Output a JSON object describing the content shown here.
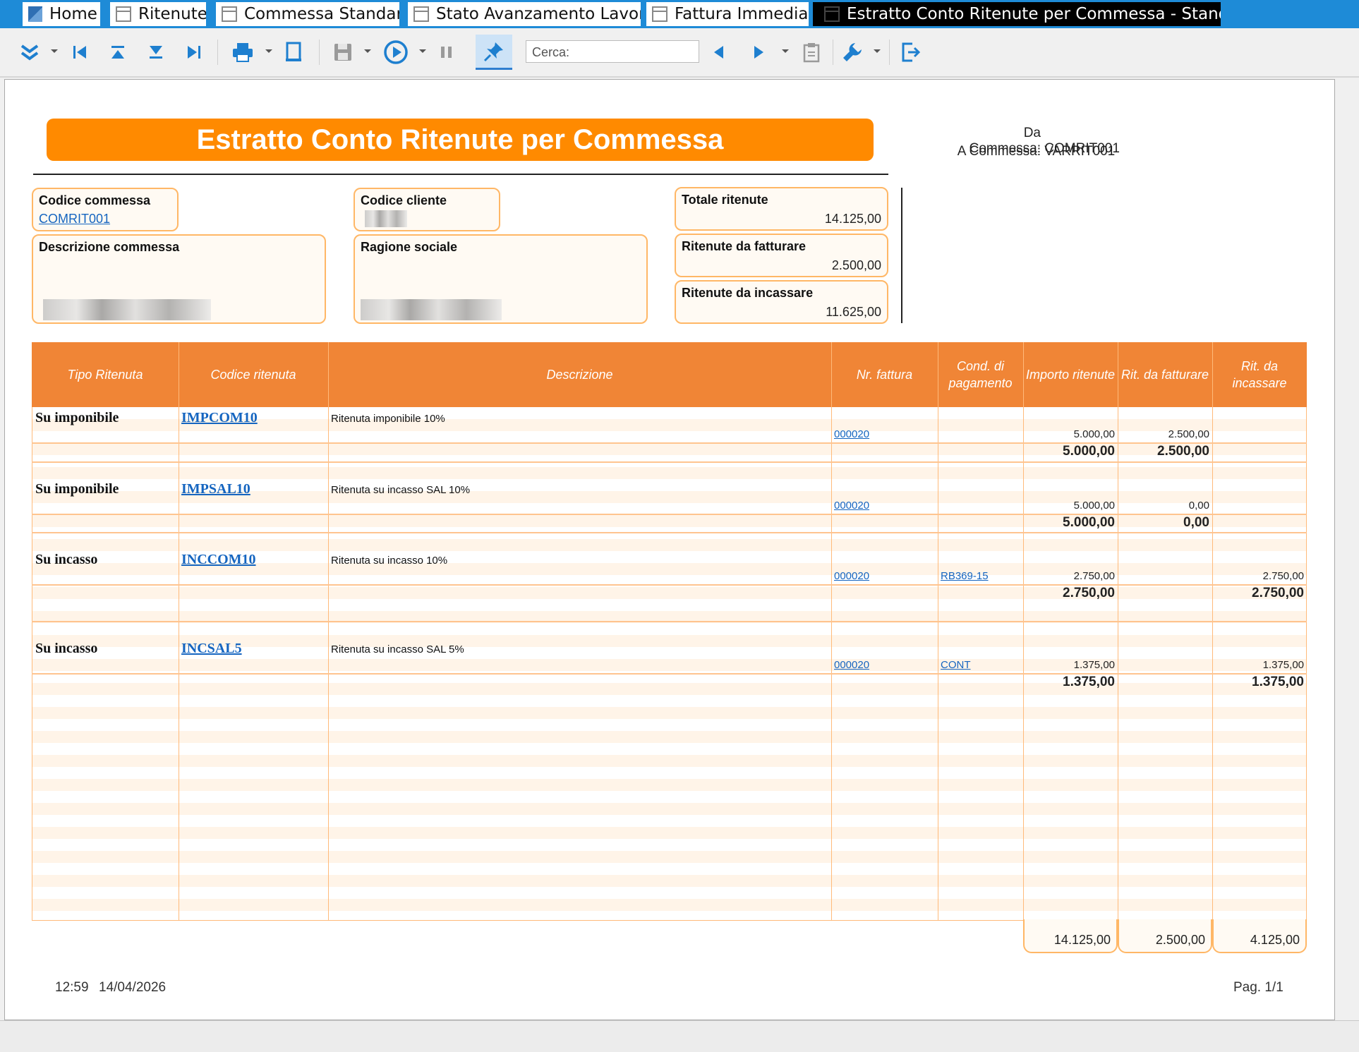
{
  "tabs": [
    {
      "label": "Home"
    },
    {
      "label": "Ritenute"
    },
    {
      "label": "Commessa Standard"
    },
    {
      "label": "Stato Avanzamento Lavori"
    },
    {
      "label": "Fattura Immediata"
    },
    {
      "label": "Estratto Conto Ritenute per Commessa - Standard"
    }
  ],
  "toolbar": {
    "search_placeholder": "Cerca:",
    "icons": [
      "expand-all-icon",
      "first-page-icon",
      "top-icon",
      "bottom-icon",
      "last-page-icon",
      "print-icon",
      "print-preview-icon",
      "save-icon",
      "play-icon",
      "pause-icon",
      "pin-icon",
      "prev-icon",
      "next-icon",
      "clipboard-icon",
      "wrench-icon",
      "exit-icon"
    ]
  },
  "report": {
    "title": "Estratto Conto Ritenute per Commessa",
    "da_label": "Da Commessa:",
    "da_value": "COMRIT001",
    "a_label": "A Commessa:",
    "a_value": "VARRIT001",
    "codice_commessa_label": "Codice commessa",
    "codice_commessa_value": "COMRIT001",
    "codice_cliente_label": "Codice cliente",
    "descrizione_commessa_label": "Descrizione commessa",
    "ragione_sociale_label": "Ragione sociale",
    "totale_ritenute_label": "Totale ritenute",
    "totale_ritenute_value": "14.125,00",
    "ritenute_da_fatturare_label": "Ritenute da fatturare",
    "ritenute_da_fatturare_value": "2.500,00",
    "ritenute_da_incassare_label": "Ritenute da incassare",
    "ritenute_da_incassare_value": "11.625,00"
  },
  "table": {
    "headers": [
      "Tipo Ritenuta",
      "Codice ritenuta",
      "Descrizione",
      "Nr. fattura",
      "Cond. di pagamento",
      "Importo ritenute",
      "Rit. da fatturare",
      "Rit. da incassare"
    ],
    "groups": [
      {
        "tipo": "Su imponibile",
        "codice": "IMPCOM10",
        "descrizione": "Ritenuta imponibile 10%",
        "nr_fattura": "000020",
        "cond": "",
        "importo": "5.000,00",
        "da_fatturare": "2.500,00",
        "da_incassare": "",
        "sub_importo": "5.000,00",
        "sub_fatturare": "2.500,00",
        "sub_incassare": ""
      },
      {
        "tipo": "Su imponibile",
        "codice": "IMPSAL10",
        "descrizione": "Ritenuta su incasso SAL 10%",
        "nr_fattura": "000020",
        "cond": "",
        "importo": "5.000,00",
        "da_fatturare": "0,00",
        "da_incassare": "",
        "sub_importo": "5.000,00",
        "sub_fatturare": "0,00",
        "sub_incassare": ""
      },
      {
        "tipo": "Su incasso",
        "codice": "INCCOM10",
        "descrizione": "Ritenuta su incasso 10%",
        "nr_fattura": "000020",
        "cond": "RB369-15",
        "importo": "2.750,00",
        "da_fatturare": "",
        "da_incassare": "2.750,00",
        "sub_importo": "2.750,00",
        "sub_fatturare": "",
        "sub_incassare": "2.750,00"
      },
      {
        "tipo": "Su incasso",
        "codice": "INCSAL5",
        "descrizione": "Ritenuta su incasso SAL 5%",
        "nr_fattura": "000020",
        "cond": "CONT",
        "importo": "1.375,00",
        "da_fatturare": "",
        "da_incassare": "1.375,00",
        "sub_importo": "1.375,00",
        "sub_fatturare": "",
        "sub_incassare": "1.375,00"
      }
    ],
    "totals": {
      "importo": "14.125,00",
      "da_fatturare": "2.500,00",
      "da_incassare": "4.125,00"
    }
  },
  "footer": {
    "time": "12:59",
    "date": "14/04/2026",
    "page": "Pag. 1/1"
  }
}
